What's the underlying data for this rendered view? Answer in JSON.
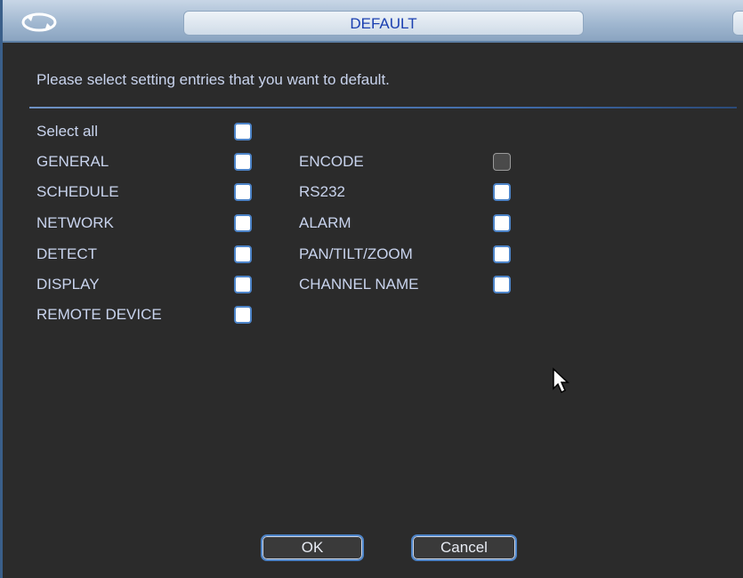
{
  "dialog": {
    "title": "DEFAULT",
    "instruction": "Please select setting entries that you want to default."
  },
  "left_options": [
    {
      "label": "Select all",
      "checked": false
    },
    {
      "label": "GENERAL",
      "checked": false
    },
    {
      "label": "SCHEDULE",
      "checked": false
    },
    {
      "label": "NETWORK",
      "checked": false
    },
    {
      "label": "DETECT",
      "checked": false
    },
    {
      "label": "DISPLAY",
      "checked": false
    },
    {
      "label": "REMOTE DEVICE",
      "checked": false
    }
  ],
  "right_options": [
    {
      "label": "ENCODE",
      "checked": false,
      "disabled": true
    },
    {
      "label": "RS232",
      "checked": false
    },
    {
      "label": "ALARM",
      "checked": false
    },
    {
      "label": "PAN/TILT/ZOOM",
      "checked": false
    },
    {
      "label": "CHANNEL NAME",
      "checked": false
    }
  ],
  "buttons": {
    "ok": "OK",
    "cancel": "Cancel"
  },
  "colors": {
    "title_text": "#1a3fb0",
    "label_text": "#c9d4ee",
    "checkbox_border": "#4d84c8",
    "background": "#2b2b2b"
  }
}
